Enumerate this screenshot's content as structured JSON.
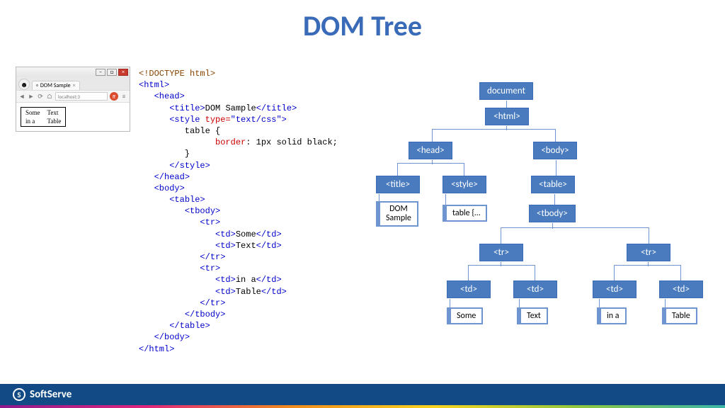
{
  "title": "DOM Tree",
  "browser": {
    "tab_label": "DOM Sample",
    "url": "localhost:3",
    "table": {
      "r1c1": "Some",
      "r1c2": "Text",
      "r2c1": "in a",
      "r2c2": "Table"
    }
  },
  "code": {
    "doctype": "<!DOCTYPE html>",
    "html_open": "<html>",
    "head_open": "<head>",
    "title_open": "<title>",
    "title_text": "DOM Sample",
    "title_close": "</title>",
    "style_open_1": "<style",
    "style_attr": " type=",
    "style_attr_val": "\"text/css\"",
    "style_open_2": ">",
    "css_selector": "         table {",
    "css_prop": "border",
    "css_val": ": 1px solid black;",
    "css_close": "         }",
    "style_close": "</style>",
    "head_close": "</head>",
    "body_open": "<body>",
    "table_open": "<table>",
    "tbody_open": "<tbody>",
    "tr_open": "<tr>",
    "td_open": "<td>",
    "td_close": "</td>",
    "cell1": "Some",
    "cell2": "Text",
    "tr_close": "</tr>",
    "cell3": "in a",
    "cell4": "Table",
    "tbody_close": "</tbody>",
    "table_close": "</table>",
    "body_close": "</body>",
    "html_close": "</html>"
  },
  "tree": {
    "document": "document",
    "html": "<html>",
    "head": "<head>",
    "body": "<body>",
    "title": "<title>",
    "style": "<style>",
    "table": "<table>",
    "title_text": "DOM\nSample",
    "style_text": "table {…",
    "tbody": "<tbody>",
    "tr": "<tr>",
    "td": "<td>",
    "leaf_some": "Some",
    "leaf_text": "Text",
    "leaf_ina": "in a",
    "leaf_table": "Table"
  },
  "footer": {
    "brand": "SoftServe"
  }
}
